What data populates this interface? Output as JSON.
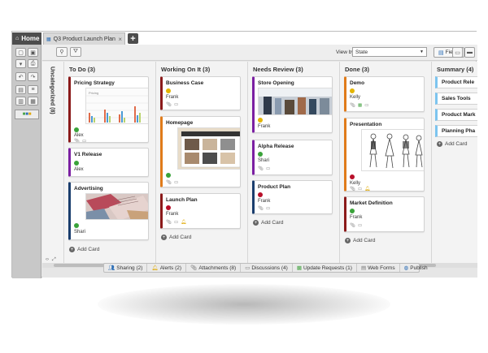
{
  "tabs": {
    "home_label": "Home",
    "doc_label": "Q3 Product Launch Plan",
    "close_glyph": "×",
    "add_glyph": "+"
  },
  "toolbar": {
    "view_by_label": "View by:",
    "view_by_value": "State",
    "fields_label": "Fields"
  },
  "board": {
    "uncategorized_label": "Uncategorized (8)",
    "add_card_label": "Add Card",
    "columns": [
      {
        "title": "To Do (3)",
        "cards": [
          {
            "title": "Pricing Strategy",
            "owner": "Alex",
            "status_color": "#3aa33a",
            "accent": "#8b1a1a"
          },
          {
            "title": "V1 Release",
            "owner": "Alex",
            "status_color": "#3aa33a",
            "accent": "#7b1fa2"
          },
          {
            "title": "Advertising",
            "owner": "Shari",
            "status_color": "#3aa33a",
            "accent": "#1a3d6d"
          }
        ]
      },
      {
        "title": "Working On It (3)",
        "cards": [
          {
            "title": "Business Case",
            "owner": "Frank",
            "status_color": "#e3b400",
            "accent": "#8b1a1a"
          },
          {
            "title": "Homepage",
            "owner": "",
            "status_color": "#3aa33a",
            "accent": "#e07b1a"
          },
          {
            "title": "Launch Plan",
            "owner": "Frank",
            "status_color": "#b8102a",
            "accent": "#8b1a1a"
          }
        ]
      },
      {
        "title": "Needs Review (3)",
        "cards": [
          {
            "title": "Store Opening",
            "owner": "Frank",
            "status_color": "#e3b400",
            "accent": "#7b1fa2"
          },
          {
            "title": "Alpha Release",
            "owner": "Shari",
            "status_color": "#3aa33a",
            "accent": "#7b1fa2"
          },
          {
            "title": "Product Plan",
            "owner": "Frank",
            "status_color": "#b8102a",
            "accent": "#1a3d6d"
          }
        ]
      },
      {
        "title": "Done (3)",
        "cards": [
          {
            "title": "Demo",
            "owner": "Kelly",
            "status_color": "#e3b400",
            "accent": "#e07b1a"
          },
          {
            "title": "Presentation",
            "owner": "Kelly",
            "status_color": "#b8102a",
            "accent": "#e07b1a"
          },
          {
            "title": "Market Definition",
            "owner": "Frank",
            "status_color": "#3aa33a",
            "accent": "#8b1a1a"
          }
        ]
      },
      {
        "title": "Summary (4)",
        "cards": [
          {
            "title": "Product Rele"
          },
          {
            "title": "Sales Tools"
          },
          {
            "title": "Product Mark"
          },
          {
            "title": "Planning Pha"
          }
        ]
      }
    ]
  },
  "bottom_bar": [
    {
      "label": "Sharing (2)",
      "icon": "sharing-icon"
    },
    {
      "label": "Alerts (2)",
      "icon": "bell-icon"
    },
    {
      "label": "Attachments (8)",
      "icon": "paperclip-icon"
    },
    {
      "label": "Discussions (4)",
      "icon": "speech-bubble-icon"
    },
    {
      "label": "Update Requests (1)",
      "icon": "update-request-icon"
    },
    {
      "label": "Web Forms",
      "icon": "web-form-icon"
    },
    {
      "label": "Publish",
      "icon": "globe-icon"
    }
  ]
}
